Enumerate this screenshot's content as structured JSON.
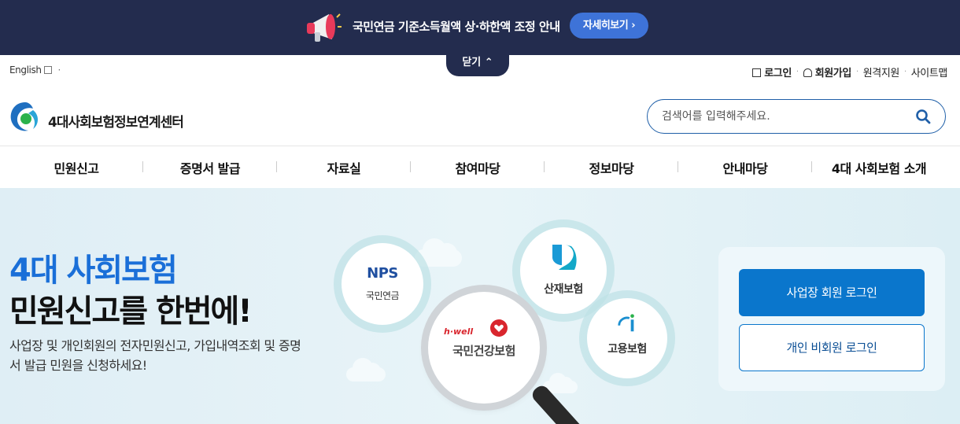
{
  "notice_bar": {
    "text": "국민연금 기준소득월액 상·하한액 조정 안내",
    "detail_label": "자세히보기 ›",
    "close_label": "닫기 ⌃"
  },
  "utility": {
    "english": "English",
    "login": "로그인",
    "signup": "회원가입",
    "remote": "원격지원",
    "sitemap": "사이트맵"
  },
  "header": {
    "site_title": "4대사회보험정보연계센터",
    "search_placeholder": "검색어를 입력해주세요."
  },
  "nav": {
    "items": [
      "민원신고",
      "증명서 발급",
      "자료실",
      "참여마당",
      "정보마당",
      "안내마당",
      "4대 사회보험 소개"
    ]
  },
  "hero": {
    "headline_1": "4대 사회보험",
    "headline_2": "민원신고를 한번에!",
    "description": "사업장 및 개인회원의 전자민원신고, 가입내역조회 및 증명서 발급 민원을 신청하세요!",
    "nps_logo": "NPS",
    "nps_label": "국민연금",
    "san_label": "산재보험",
    "emp_label": "고용보험",
    "nhi_logo": "h·well",
    "nhi_label": "국민건강보험"
  },
  "login": {
    "business_label": "사업장 회원 로그인",
    "individual_label": "개인 비회원 로그인"
  },
  "colors": {
    "topbar": "#232c4e",
    "accent_blue": "#0a76cc",
    "headline_blue": "#1a6fd8"
  }
}
